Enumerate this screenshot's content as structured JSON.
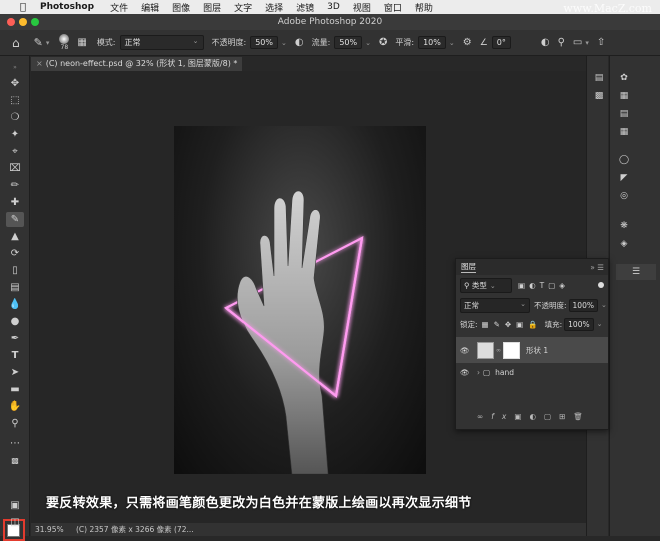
{
  "menubar": {
    "app": "Photoshop",
    "items": [
      "文件",
      "编辑",
      "图像",
      "图层",
      "文字",
      "选择",
      "滤镜",
      "3D",
      "视图",
      "窗口",
      "帮助"
    ]
  },
  "watermark": "www.MacZ.com",
  "window": {
    "title": "Adobe Photoshop 2020"
  },
  "options": {
    "brush_size": "78",
    "mode_label": "模式:",
    "mode_value": "正常",
    "opacity_label": "不透明度:",
    "opacity_value": "50%",
    "flow_label": "流量:",
    "flow_value": "50%",
    "smooth_label": "平滑:",
    "smooth_value": "10%",
    "angle_value": "0°"
  },
  "document": {
    "tab_title": "(C) neon-effect.psd @ 32% (形状 1, 图层蒙版/8) *"
  },
  "layers_panel": {
    "title": "图层",
    "filter_kind": "类型",
    "blend_mode": "正常",
    "opacity_label": "不透明度:",
    "opacity_value": "100%",
    "lock_label": "锁定:",
    "fill_label": "填充:",
    "fill_value": "100%",
    "layers": [
      {
        "name": "形状 1",
        "selected": true
      },
      {
        "name": "hand",
        "selected": false
      }
    ]
  },
  "status": {
    "zoom": "31.95%",
    "info": "(C) 2357 像素 x 3266 像素 (72..."
  },
  "caption": "要反转效果，只需将画笔颜色更改为白色并在蒙版上绘画以再次显示细节",
  "colors": {
    "neon": "#ff9bf0",
    "highlight": "#e23b2e",
    "foreground": "#ffffff"
  }
}
